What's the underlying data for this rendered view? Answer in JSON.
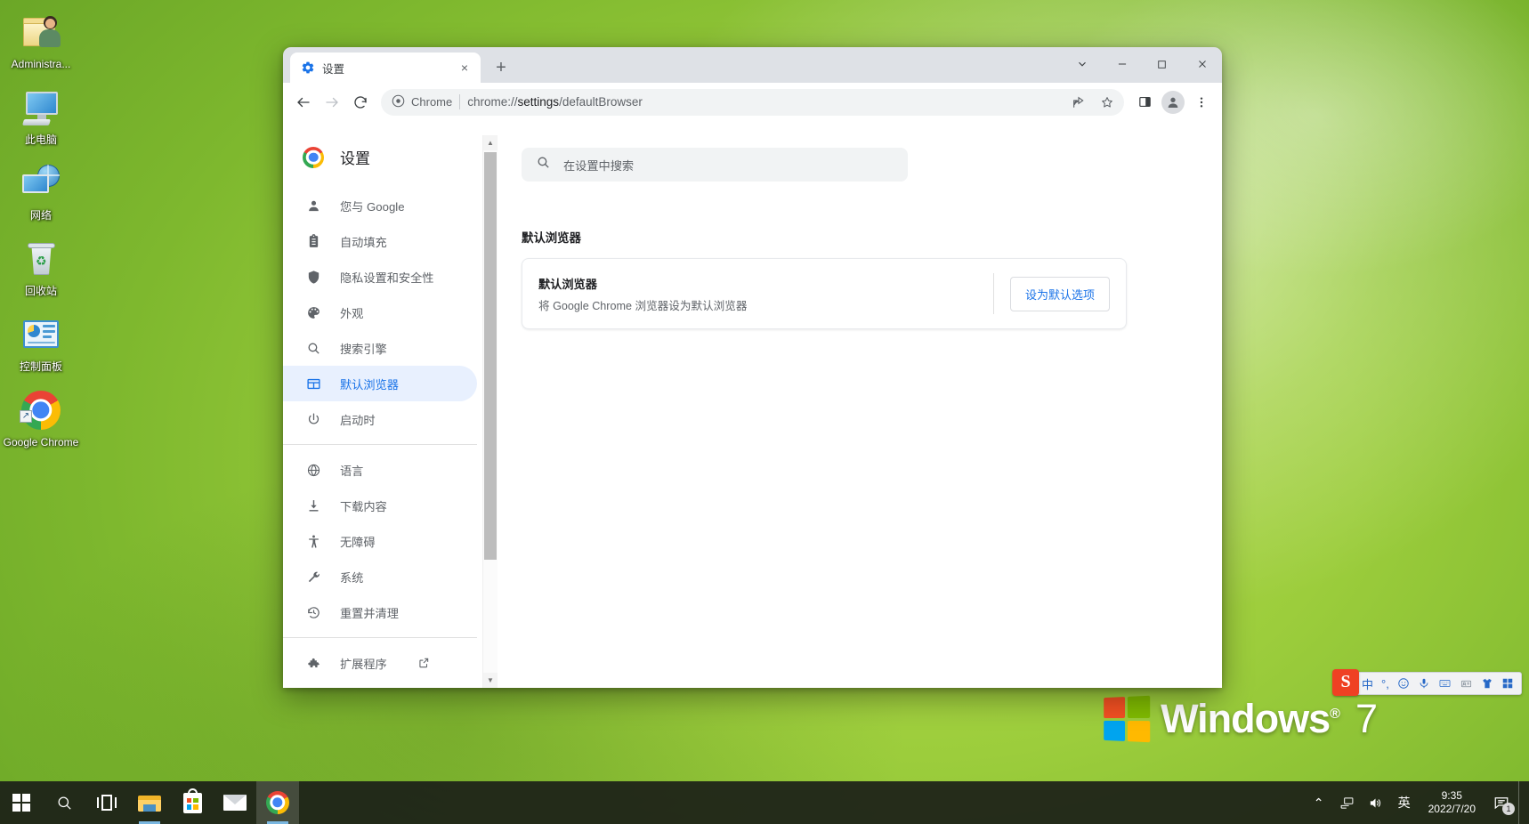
{
  "desktop": {
    "icons": [
      {
        "label": "Administra...",
        "icon": "user-folder-icon"
      },
      {
        "label": "此电脑",
        "icon": "this-pc-icon"
      },
      {
        "label": "网络",
        "icon": "network-icon"
      },
      {
        "label": "回收站",
        "icon": "recycle-bin-icon"
      },
      {
        "label": "控制面板",
        "icon": "control-panel-icon"
      },
      {
        "label": "Google Chrome",
        "icon": "chrome-shortcut-icon"
      }
    ],
    "watermark": {
      "brand": "Windows",
      "trademark": "®",
      "version": "7"
    }
  },
  "browser": {
    "tab": {
      "title": "设置",
      "favicon": "settings-gear-icon",
      "close": "×"
    },
    "newtab_label": "+",
    "window_controls": {
      "search_tabs": "⌄",
      "minimize": "—",
      "maximize": "▢",
      "close": "✕"
    },
    "nav": {
      "back": "←",
      "forward": "→",
      "reload": "⟳"
    },
    "omnibox": {
      "chip_label": "Chrome",
      "url_prefix": "chrome://",
      "url_bold": "settings",
      "url_suffix": "/defaultBrowser",
      "full_url": "chrome://settings/defaultBrowser"
    },
    "toolbar_icons": [
      "share-icon",
      "bookmark-star-icon",
      "side-panel-icon",
      "profile-avatar-icon",
      "three-dot-menu-icon"
    ]
  },
  "settings": {
    "brand_title": "设置",
    "search": {
      "placeholder": "在设置中搜索",
      "value": "",
      "icon": "search-icon"
    },
    "menu": [
      {
        "label": "您与 Google",
        "icon": "person-icon",
        "active": false
      },
      {
        "label": "自动填充",
        "icon": "clipboard-icon",
        "active": false
      },
      {
        "label": "隐私设置和安全性",
        "icon": "shield-icon",
        "active": false
      },
      {
        "label": "外观",
        "icon": "palette-icon",
        "active": false
      },
      {
        "label": "搜索引擎",
        "icon": "search-icon",
        "active": false
      },
      {
        "label": "默认浏览器",
        "icon": "browser-window-icon",
        "active": true
      },
      {
        "label": "启动时",
        "icon": "power-icon",
        "active": false
      }
    ],
    "menu2": [
      {
        "label": "语言",
        "icon": "globe-icon"
      },
      {
        "label": "下载内容",
        "icon": "download-icon"
      },
      {
        "label": "无障碍",
        "icon": "accessibility-icon"
      },
      {
        "label": "系统",
        "icon": "wrench-icon"
      },
      {
        "label": "重置并清理",
        "icon": "restore-icon"
      }
    ],
    "menu3": [
      {
        "label": "扩展程序",
        "icon": "puzzle-icon",
        "external": true
      }
    ],
    "section_title": "默认浏览器",
    "card": {
      "title": "默认浏览器",
      "description": "将 Google Chrome 浏览器设为默认浏览器",
      "button_label": "设为默认选项"
    },
    "colors": {
      "accent": "#1a73e8",
      "active_bg": "#e8f0fe",
      "text": "#202124",
      "muted": "#5f6368"
    }
  },
  "ime": {
    "logo": "S",
    "items": [
      {
        "icon": "chinese-mode-icon",
        "glyph": "中"
      },
      {
        "icon": "punctuation-icon",
        "glyph": "°,"
      },
      {
        "icon": "emoji-icon",
        "glyph": "☺"
      },
      {
        "icon": "voice-input-icon",
        "glyph": "🎤"
      },
      {
        "icon": "soft-keyboard-icon",
        "glyph": "⌨"
      },
      {
        "icon": "user-card-icon",
        "glyph": "🪪"
      },
      {
        "icon": "skin-icon",
        "glyph": "👕"
      },
      {
        "icon": "toolbox-icon",
        "glyph": "▦"
      }
    ]
  },
  "taskbar": {
    "start": "start-button",
    "items": [
      {
        "name": "start-button",
        "icon": "windows-logo-icon"
      },
      {
        "name": "search-button",
        "icon": "search-icon"
      },
      {
        "name": "task-view-button",
        "icon": "task-view-icon"
      },
      {
        "name": "file-explorer-button",
        "icon": "folder-icon"
      },
      {
        "name": "microsoft-store-button",
        "icon": "store-icon"
      },
      {
        "name": "mail-button",
        "icon": "mail-icon"
      },
      {
        "name": "chrome-taskbar-button",
        "icon": "chrome-icon"
      }
    ],
    "tray": [
      {
        "name": "tray-overflow",
        "glyph": "⌃"
      },
      {
        "name": "network-icon",
        "glyph": "🖧"
      },
      {
        "name": "volume-icon",
        "glyph": "🔊"
      },
      {
        "name": "language-indicator",
        "glyph": "英"
      }
    ],
    "clock": {
      "time": "9:35",
      "date": "2022/7/20"
    },
    "notifications": {
      "icon": "action-center-icon",
      "count": "1"
    }
  }
}
